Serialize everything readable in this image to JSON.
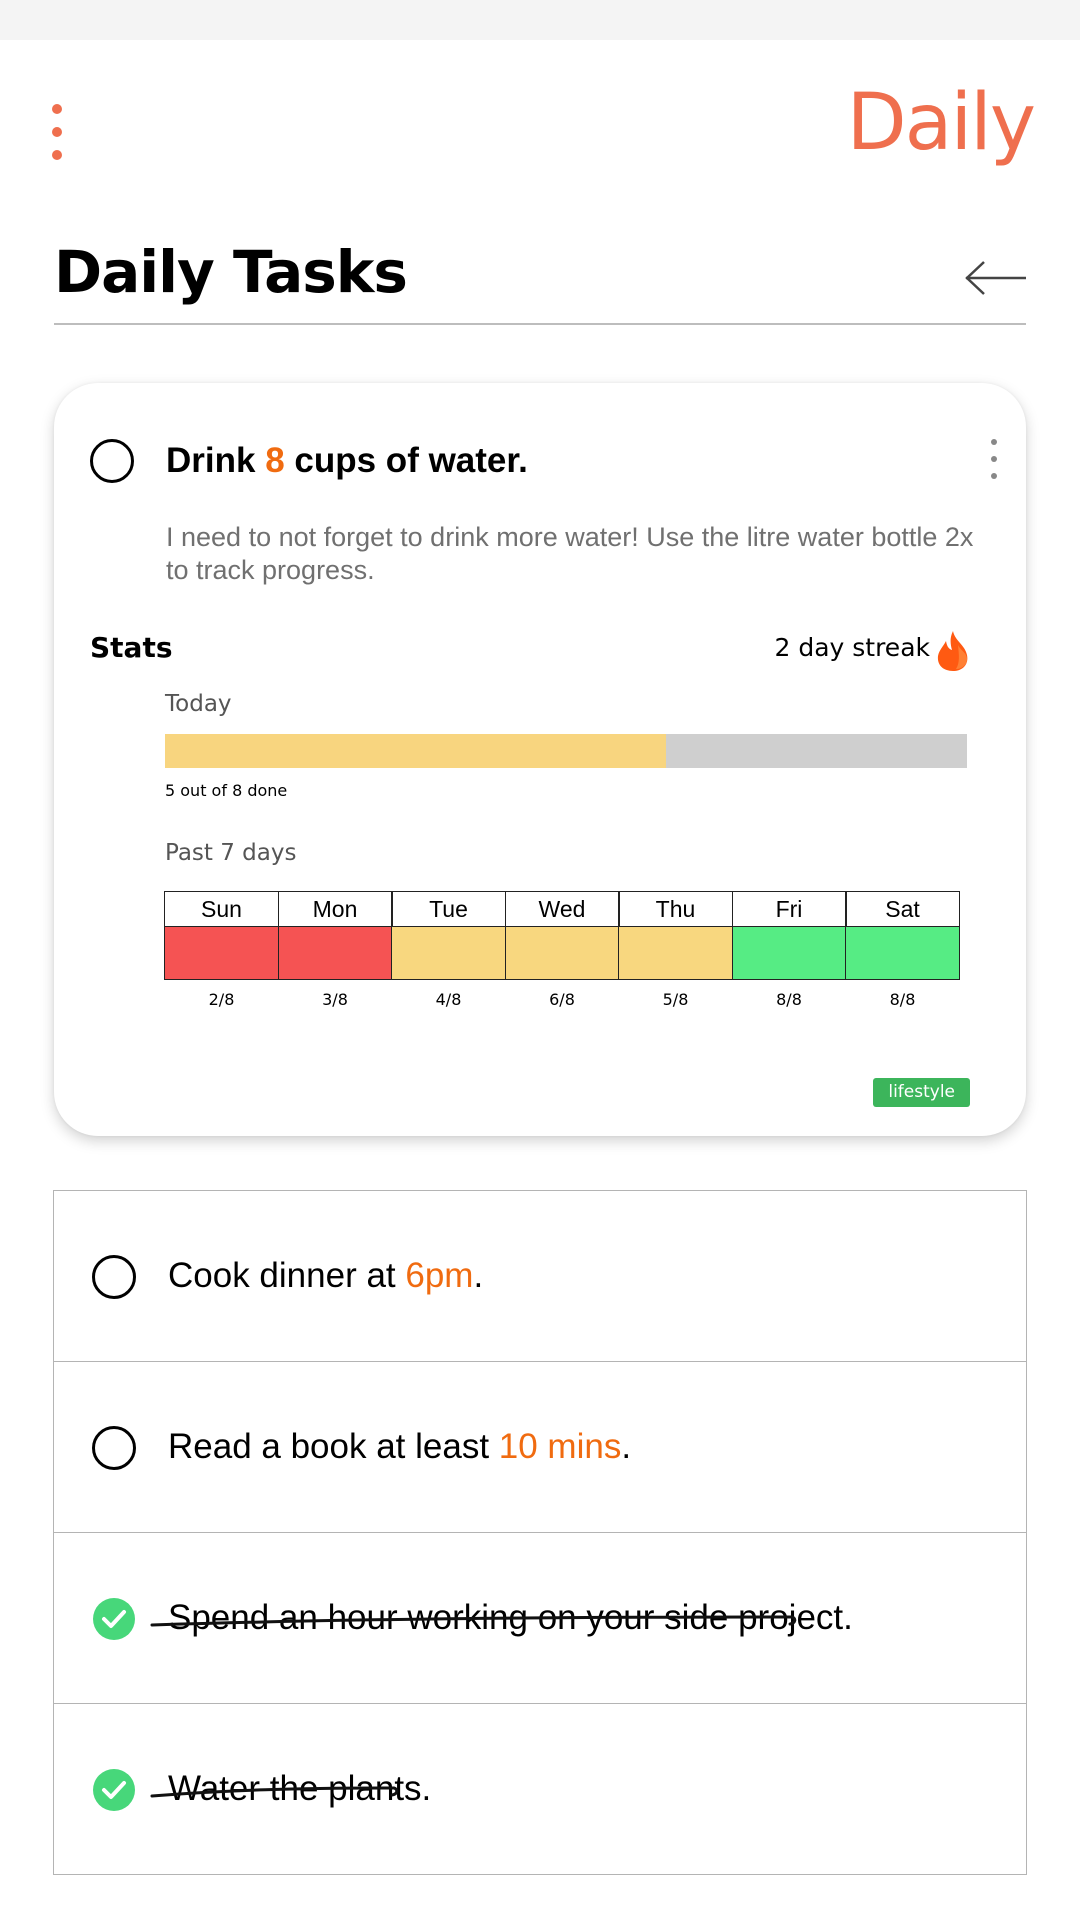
{
  "app": {
    "logo_text": "Daily",
    "brand_color": "#ef6f4e"
  },
  "header": {
    "title": "Daily Tasks"
  },
  "featured_task": {
    "title_pre": "Drink ",
    "title_highlight": "8",
    "title_post": " cups of water.",
    "description": "I need to not forget to drink more water! Use the litre water bottle 2x to track progress.",
    "stats_label": "Stats",
    "streak_text": "2 day streak",
    "today_label": "Today",
    "progress": {
      "done": 5,
      "total": 8,
      "text": "5 out of 8 done"
    },
    "past_label": "Past 7 days",
    "week": [
      {
        "day": "Sun",
        "count": "2/8",
        "color": "#f55353"
      },
      {
        "day": "Mon",
        "count": "3/8",
        "color": "#f55353"
      },
      {
        "day": "Tue",
        "count": "4/8",
        "color": "#f8d77f"
      },
      {
        "day": "Wed",
        "count": "6/8",
        "color": "#f8d77f"
      },
      {
        "day": "Thu",
        "count": "5/8",
        "color": "#f8d77f"
      },
      {
        "day": "Fri",
        "count": "8/8",
        "color": "#56ec84"
      },
      {
        "day": "Sat",
        "count": "8/8",
        "color": "#56ec84"
      }
    ],
    "tag": "lifestyle"
  },
  "tasks": [
    {
      "pre": "Cook dinner at ",
      "highlight": "6pm",
      "post": ".",
      "done": false
    },
    {
      "pre": "Read a book at least ",
      "highlight": "10 mins",
      "post": ".",
      "done": false
    },
    {
      "pre": "Spend an hour working on your side project.",
      "highlight": "",
      "post": "",
      "done": true
    },
    {
      "pre": "Water the plants.",
      "highlight": "",
      "post": "",
      "done": true
    }
  ],
  "colors": {
    "accent": "#f06b10",
    "check": "#47d77a",
    "tag": "#3cb55b"
  }
}
